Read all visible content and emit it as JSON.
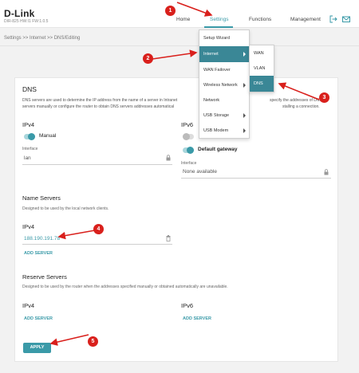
{
  "header": {
    "logo": "D-Link",
    "model": "DIR-825  HW:I1  FW:1.0.5",
    "nav": [
      "Home",
      "Settings",
      "Functions",
      "Management"
    ],
    "icons": [
      "logout-icon",
      "mail-icon"
    ],
    "accent": "#3a9aa8"
  },
  "breadcrumb": "Settings >> Internet >> DNS/Editing",
  "dns": {
    "title": "DNS",
    "description_line1": "DNS servers are used to determine the IP address from the name of a server in Intranet",
    "description_line1b": "specify the addresses of DNS",
    "description_line2": "servers manually or configure the router to obtain DNS servers addresses automatical",
    "description_line2b": "stalling a connection.",
    "ipv4": {
      "label": "IPv4",
      "mode": "Manual",
      "interface_label": "Interface",
      "interface_value": "lan"
    },
    "ipv6": {
      "label": "IPv6",
      "toggle_label": "Default gateway",
      "interface_label": "Interface",
      "interface_value": "None available"
    }
  },
  "name_servers": {
    "title": "Name Servers",
    "description": "Designed to be used by the local network clients.",
    "ipv4_label": "IPv4",
    "ipv4_value": "188.190.191.78",
    "add_server": "ADD SERVER"
  },
  "reserve_servers": {
    "title": "Reserve Servers",
    "description": "Designed to be used by the router when the addresses specified manually or obtained automatically are unavailable.",
    "ipv4_label": "IPv4",
    "ipv6_label": "IPv6",
    "add_server_ipv4": "ADD SERVER",
    "add_server_ipv6": "ADD SERVER"
  },
  "apply": "APPLY",
  "settings_menu": [
    "Setup Wizard",
    "Internet",
    "WAN Failover",
    "Wireless Network",
    "Network",
    "USB Storage",
    "USB Modem"
  ],
  "internet_submenu": [
    "WAN",
    "VLAN",
    "DNS"
  ],
  "annotations": [
    "1",
    "2",
    "3",
    "4",
    "5"
  ],
  "annotation_color": "#d9201c"
}
